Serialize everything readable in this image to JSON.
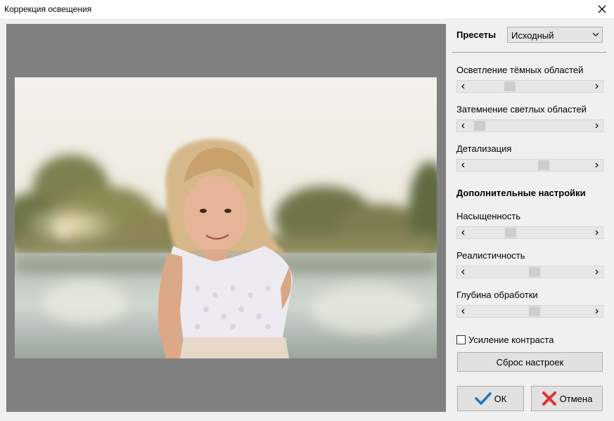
{
  "window": {
    "title": "Коррекция освещения"
  },
  "presets": {
    "label": "Пресеты",
    "selected": "Исходный"
  },
  "sliders": [
    {
      "label": "Осветление тёмных областей",
      "value": 0.32
    },
    {
      "label": "Затемнение светлых областей",
      "value": 0.05
    },
    {
      "label": "Детализация",
      "value": 0.62
    }
  ],
  "advanced": {
    "title": "Дополнительные настройки",
    "sliders": [
      {
        "label": "Насыщенность",
        "value": 0.33
      },
      {
        "label": "Реалистичность",
        "value": 0.54
      },
      {
        "label": "Глубина обработки",
        "value": 0.54
      }
    ]
  },
  "contrast": {
    "label": "Усиление контраста",
    "checked": false
  },
  "buttons": {
    "reset": "Сброс настроек",
    "ok": "ОК",
    "cancel": "Отмена"
  },
  "colors": {
    "preview_bg": "#808080",
    "ok_check": "#1a78c2",
    "cancel_x": "#e03030"
  },
  "icons": {
    "close": "close-icon",
    "dropdown": "chevron-down-icon",
    "ok": "checkmark-icon",
    "cancel": "x-icon"
  }
}
